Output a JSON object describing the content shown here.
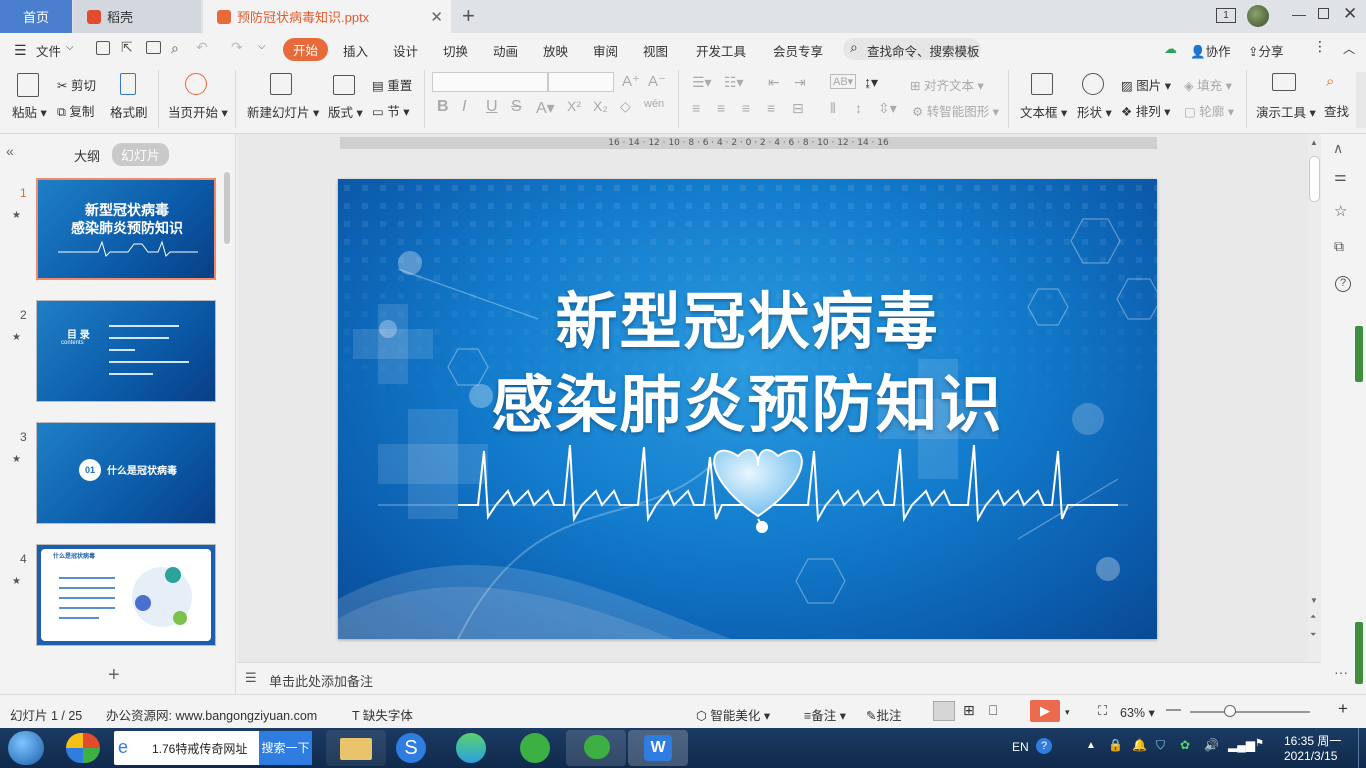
{
  "tabs": {
    "home": "首页",
    "daoke": "稻壳",
    "file": "预防冠状病毒知识.pptx",
    "window_count": "1"
  },
  "menu": {
    "file": "文件",
    "items": [
      "开始",
      "插入",
      "设计",
      "切换",
      "动画",
      "放映",
      "审阅",
      "视图",
      "开发工具",
      "会员专享"
    ],
    "search": "查找命令、搜索模板",
    "collab": "协作",
    "share": "分享"
  },
  "ribbon": {
    "paste": "粘贴",
    "cut": "剪切",
    "copy": "复制",
    "format_painter": "格式刷",
    "play_from_current": "当页开始",
    "new_slide": "新建幻灯片",
    "layout": "版式",
    "reset": "重置",
    "section": "节",
    "align_text": "对齐文本",
    "smart_shape": "转智能图形",
    "textbox": "文本框",
    "shape": "形状",
    "picture": "图片",
    "fill": "填充",
    "arrange": "排列",
    "outline": "轮廓",
    "presentation_tools": "演示工具",
    "find": "查找"
  },
  "leftpane": {
    "outline_tab": "大纲",
    "slides_tab": "幻灯片",
    "thumbs": [
      {
        "num": "1",
        "line1": "新型冠状病毒",
        "line2": "感染肺炎预防知识"
      },
      {
        "num": "2",
        "title": "目 录",
        "sub": "contents"
      },
      {
        "num": "3",
        "badge": "01",
        "title": "什么是冠状病毒"
      },
      {
        "num": "4",
        "title": "什么是冠状病毒"
      }
    ]
  },
  "slide": {
    "line1": "新型冠状病毒",
    "line2": "感染肺炎预防知识"
  },
  "ruler": "16 · 14 · 12 · 10 · 8 · 6 · 4 · 2 · 0 · 2 · 4 · 6 · 8 · 10 · 12 · 14 · 16",
  "notes": "单击此处添加备注",
  "status": {
    "slide_counter": "幻灯片 1 / 25",
    "source": "办公资源网: www.bangongziyuan.com",
    "missing_font": "缺失字体",
    "beautify": "智能美化",
    "notes": "备注",
    "comments": "批注",
    "zoom": "63%"
  },
  "taskbar": {
    "ie_text": "1.76特戒传奇网址",
    "search_btn": "搜索一下",
    "lang": "EN",
    "time": "16:35 周一",
    "date": "2021/3/15"
  },
  "colors": {
    "accent": "#e8693a",
    "tab_home": "#4a7fd0",
    "slide_blue": "#137ccd"
  }
}
